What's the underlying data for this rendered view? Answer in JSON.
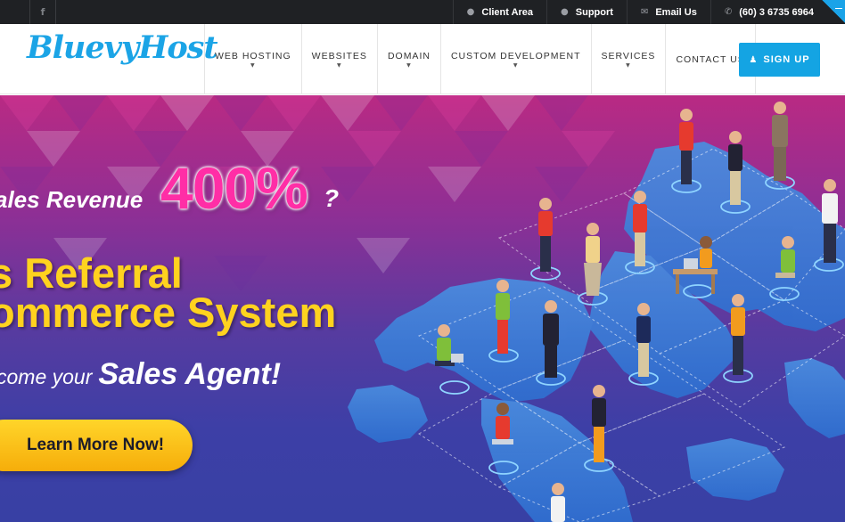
{
  "topbar": {
    "social": {
      "icon": "facebook-icon",
      "glyph": "f"
    },
    "links": [
      {
        "label": "Client Area",
        "icon": "info-circle-icon"
      },
      {
        "label": "Support",
        "icon": "info-circle-icon"
      },
      {
        "label": "Email Us",
        "icon": "envelope-icon"
      },
      {
        "label": "(60) 3 6735 6964",
        "icon": "phone-icon"
      }
    ]
  },
  "header": {
    "logo_text": "BluevyHost",
    "nav": [
      {
        "label": "WEB HOSTING",
        "has_dropdown": true
      },
      {
        "label": "WEBSITES",
        "has_dropdown": true
      },
      {
        "label": "DOMAIN",
        "has_dropdown": true
      },
      {
        "label": "CUSTOM DEVELOPMENT",
        "has_dropdown": true
      },
      {
        "label": "SERVICES",
        "has_dropdown": true
      },
      {
        "label": "CONTACT US",
        "has_dropdown": false
      }
    ],
    "signup_label": "SIGN UP",
    "signup_icon": "user-icon"
  },
  "hero": {
    "sales_revenue": "ales Revenue",
    "percent": "400%",
    "question": "?",
    "line1": "s Referral",
    "line2": "ommerce System",
    "agent_prefix": "come your",
    "agent_emphasis": "Sales Agent!",
    "cta_label": "Learn More Now!"
  },
  "colors": {
    "accent": "#14a4e3",
    "topbar_bg": "#1f2124",
    "percent_pink": "#ff2ea6",
    "headline_yellow": "#ffd21f",
    "cta_yellow": "#f6b80f",
    "hero_top": "#b92a83",
    "hero_bottom": "#3840a4"
  }
}
